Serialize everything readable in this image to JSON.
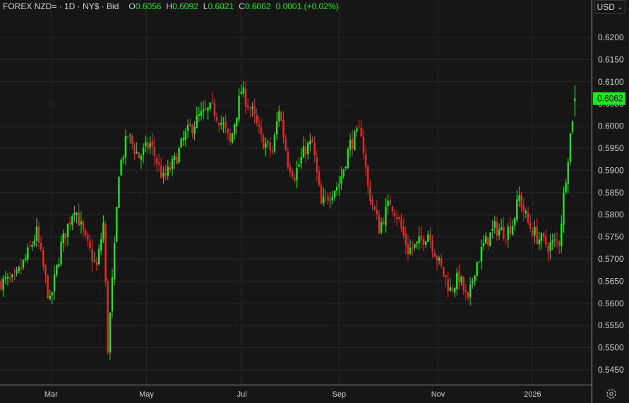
{
  "header": {
    "symbol": "FOREX NZD= · 1D · NY$ · Bid",
    "open_label": "O",
    "open": "0.6056",
    "high_label": "H",
    "high": "0.6092",
    "low_label": "L",
    "low": "0.6021",
    "close_label": "C",
    "close": "0.6062",
    "change": "0.0001 (+0.02%)"
  },
  "currency_button": {
    "label": "USD",
    "icon": "chevron-down-icon"
  },
  "settings_icon": "gear-icon",
  "colors": {
    "up": "#1fe61f",
    "down": "#e52a2a",
    "background": "#161616",
    "grid": "#262626",
    "last_price": "#1fe61f"
  },
  "chart_data": {
    "type": "candlestick",
    "title": "FOREX NZD= 1D",
    "ylim": [
      0.5425,
      0.6225
    ],
    "y_ticks": [
      "0.6200",
      "0.6150",
      "0.6100",
      "0.6050",
      "0.6000",
      "0.5950",
      "0.5900",
      "0.5850",
      "0.5800",
      "0.5750",
      "0.5700",
      "0.5650",
      "0.5600",
      "0.5550",
      "0.5500",
      "0.5450"
    ],
    "last_price": "0.6062",
    "total_days": 259,
    "x_ticks": [
      {
        "label": "Mar",
        "day": 22.5
      },
      {
        "label": "May",
        "day": 65.4
      },
      {
        "label": "Jul",
        "day": 108.3
      },
      {
        "label": "Sep",
        "day": 152
      },
      {
        "label": "Nov",
        "day": 196.5
      },
      {
        "label": "2026",
        "day": 239
      }
    ],
    "close_waypoints": [
      [
        0,
        0.5648
      ],
      [
        6,
        0.565
      ],
      [
        11,
        0.57
      ],
      [
        16,
        0.5759
      ],
      [
        22,
        0.56
      ],
      [
        27,
        0.573
      ],
      [
        33,
        0.582
      ],
      [
        38,
        0.574
      ],
      [
        43,
        0.568
      ],
      [
        46,
        0.578
      ],
      [
        48,
        0.55
      ],
      [
        51,
        0.572
      ],
      [
        53,
        0.59
      ],
      [
        57,
        0.598
      ],
      [
        62,
        0.593
      ],
      [
        67,
        0.596
      ],
      [
        73,
        0.588
      ],
      [
        78,
        0.592
      ],
      [
        83,
        0.598
      ],
      [
        89,
        0.602
      ],
      [
        95,
        0.604
      ],
      [
        100,
        0.6
      ],
      [
        103,
        0.596
      ],
      [
        108,
        0.608
      ],
      [
        113,
        0.603
      ],
      [
        117,
        0.597
      ],
      [
        122,
        0.594
      ],
      [
        125,
        0.604
      ],
      [
        129,
        0.592
      ],
      [
        132,
        0.589
      ],
      [
        137,
        0.595
      ],
      [
        140,
        0.596
      ],
      [
        144,
        0.582
      ],
      [
        148,
        0.585
      ],
      [
        152,
        0.587
      ],
      [
        157,
        0.596
      ],
      [
        162,
        0.599
      ],
      [
        165,
        0.586
      ],
      [
        170,
        0.577
      ],
      [
        175,
        0.583
      ],
      [
        178,
        0.58
      ],
      [
        183,
        0.572
      ],
      [
        187,
        0.573
      ],
      [
        192,
        0.576
      ],
      [
        197,
        0.569
      ],
      [
        202,
        0.563
      ],
      [
        206,
        0.566
      ],
      [
        210,
        0.56
      ],
      [
        213,
        0.568
      ],
      [
        217,
        0.573
      ],
      [
        222,
        0.577
      ],
      [
        227,
        0.576
      ],
      [
        230,
        0.578
      ],
      [
        233,
        0.584
      ],
      [
        237,
        0.578
      ],
      [
        241,
        0.575
      ],
      [
        246,
        0.573
      ],
      [
        251,
        0.574
      ],
      [
        254,
        0.589
      ],
      [
        256,
        0.598
      ],
      [
        258,
        0.6062
      ]
    ]
  }
}
